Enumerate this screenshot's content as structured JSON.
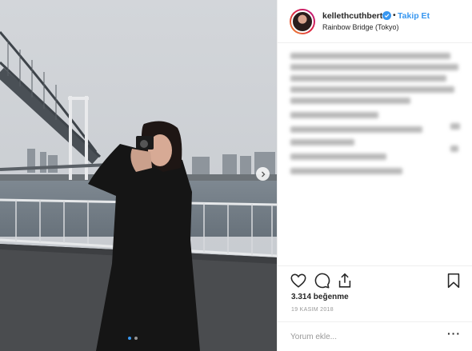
{
  "post": {
    "username": "kellethcuthbert",
    "separator": "•",
    "follow_label": "Takip Et",
    "location": "Rainbow Bridge (Tokyo)",
    "likes": "3.314 beğenme",
    "date": "19 KASIM 2018",
    "comment_placeholder": "Yorum ekle...",
    "more_label": "···"
  },
  "icons": [
    "heart-icon",
    "comment-icon",
    "share-icon",
    "bookmark-icon",
    "verified-badge-icon",
    "chevron-right-icon"
  ],
  "colors": {
    "accent": "#3897f0",
    "text": "#262626",
    "muted": "#999999",
    "border": "#efefef"
  }
}
